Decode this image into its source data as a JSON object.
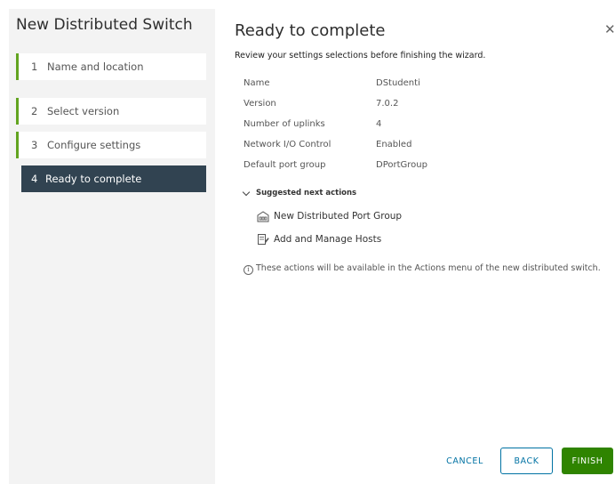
{
  "wizard": {
    "title": "New Distributed Switch",
    "steps": [
      {
        "num": "1",
        "label": "Name and location",
        "state": "done"
      },
      {
        "num": "2",
        "label": "Select version",
        "state": "done"
      },
      {
        "num": "3",
        "label": "Configure settings",
        "state": "done"
      },
      {
        "num": "4",
        "label": "Ready to complete",
        "state": "active"
      }
    ]
  },
  "page": {
    "title": "Ready to complete",
    "subtitle": "Review your settings selections before finishing the wizard.",
    "close_glyph": "✕"
  },
  "summary": [
    {
      "key": "Name",
      "value": "DStudenti"
    },
    {
      "key": "Version",
      "value": "7.0.2"
    },
    {
      "key": "Number of uplinks",
      "value": "4"
    },
    {
      "key": "Network I/O Control",
      "value": "Enabled"
    },
    {
      "key": "Default port group",
      "value": "DPortGroup"
    }
  ],
  "next_actions": {
    "header": "Suggested next actions",
    "items": [
      {
        "label": "New Distributed Port Group",
        "icon": "port-group-icon"
      },
      {
        "label": "Add and Manage Hosts",
        "icon": "manage-hosts-icon"
      }
    ],
    "note": "These actions will be available in the Actions menu of the new distributed switch.",
    "note_icon": "i"
  },
  "buttons": {
    "cancel": "CANCEL",
    "back": "BACK",
    "finish": "FINISH"
  },
  "colors": {
    "accent_green": "#62a420",
    "active_step_bg": "#314351",
    "link_blue": "#0072a3",
    "finish_green": "#2f8400"
  }
}
